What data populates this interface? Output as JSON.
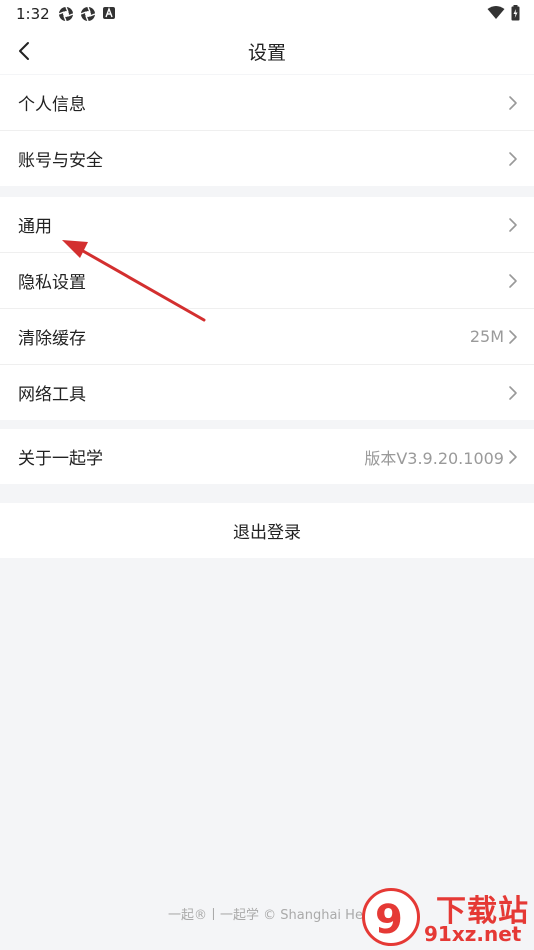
{
  "status_bar": {
    "time": "1:32"
  },
  "nav": {
    "title": "设置"
  },
  "groups": [
    {
      "items": [
        {
          "label": "个人信息",
          "value": ""
        },
        {
          "label": "账号与安全",
          "value": ""
        }
      ]
    },
    {
      "items": [
        {
          "label": "通用",
          "value": ""
        },
        {
          "label": "隐私设置",
          "value": ""
        },
        {
          "label": "清除缓存",
          "value": "25M"
        },
        {
          "label": "网络工具",
          "value": ""
        }
      ]
    },
    {
      "items": [
        {
          "label": "关于一起学",
          "value": "版本V3.9.20.1009"
        }
      ]
    }
  ],
  "logout": {
    "label": "退出登录"
  },
  "footer": {
    "text": "一起®丨一起学 © Shanghai Hexu"
  },
  "watermark": {
    "title": "下载站",
    "url": "91xz.net",
    "glyph": "9"
  },
  "colors": {
    "annotation_arrow": "#d32f2f",
    "watermark": "#e53935"
  }
}
